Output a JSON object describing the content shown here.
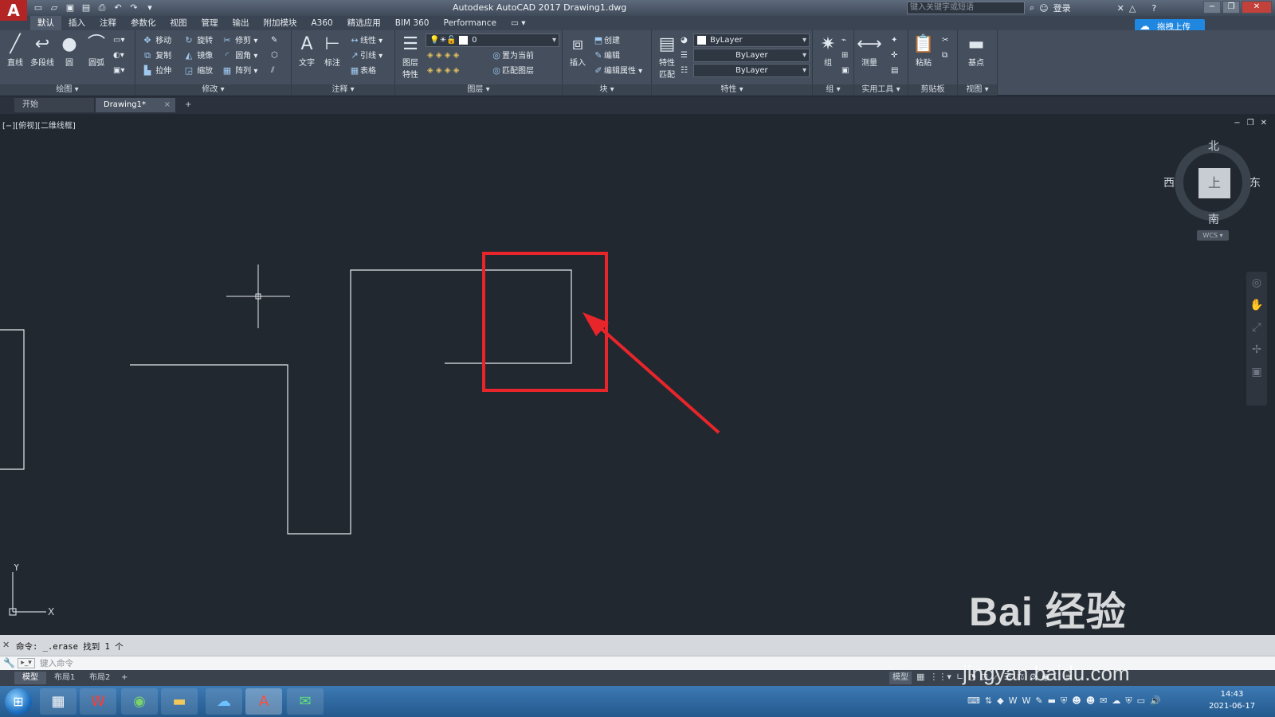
{
  "window": {
    "app_logo": "A",
    "title": "Autodesk AutoCAD 2017    Drawing1.dwg",
    "search_placeholder": "键入关键字或短语",
    "login_label": "登录",
    "upload_label": "拖拽上传"
  },
  "ribbon_tabs": [
    "默认",
    "插入",
    "注释",
    "参数化",
    "视图",
    "管理",
    "输出",
    "附加模块",
    "A360",
    "精选应用",
    "BIM 360",
    "Performance"
  ],
  "ribbon": {
    "draw": {
      "title": "绘图 ▾",
      "line": "直线",
      "polyline": "多段线",
      "circle": "圆",
      "arc": "圆弧"
    },
    "modify": {
      "title": "修改 ▾",
      "move": "移动",
      "rotate": "旋转",
      "trim": "修剪",
      "copy": "复制",
      "mirror": "镜像",
      "fillet": "圆角",
      "stretch": "拉伸",
      "scale": "缩放",
      "array": "阵列"
    },
    "annotation": {
      "title": "注释 ▾",
      "text": "文字",
      "dimension": "标注",
      "linear": "线性",
      "leader": "引线",
      "table": "表格"
    },
    "layers": {
      "title": "图层 ▾",
      "layer_props": "图层\n特性",
      "layer_value": "0",
      "set_current": "置为当前",
      "match_layer": "匹配图层"
    },
    "block": {
      "title": "块 ▾",
      "insert": "插入",
      "create": "创建",
      "edit": "编辑",
      "edit_attr": "编辑属性"
    },
    "properties": {
      "title": "特性 ▾",
      "match": "特性\n匹配",
      "color": "ByLayer",
      "linetype": "ByLayer",
      "lineweight": "ByLayer"
    },
    "groups": {
      "title": "组 ▾",
      "group": "组"
    },
    "utilities": {
      "title": "实用工具 ▾",
      "measure": "测量"
    },
    "clipboard": {
      "title": "剪贴板",
      "paste": "粘贴"
    },
    "view": {
      "title": "视图 ▾",
      "base": "基点"
    }
  },
  "file_tabs": {
    "start": "开始",
    "doc": "Drawing1*",
    "close": "×",
    "new": "+"
  },
  "viewport": {
    "label": "[−][俯视][二维线框]",
    "viewcube": {
      "north": "北",
      "south": "南",
      "west": "西",
      "east": "东",
      "top": "上",
      "wcs": "WCS ▾"
    },
    "ucs": {
      "x": "X",
      "y": "Y"
    }
  },
  "command": {
    "history": "命令: _.erase 找到 1 个",
    "placeholder": "键入命令",
    "prefix": "▸_▾"
  },
  "layout_tabs": [
    "模型",
    "布局1",
    "布局2",
    "+"
  ],
  "status": {
    "model": "模型"
  },
  "taskbar": {
    "clock_time": "14:43",
    "clock_date": "2021-06-17"
  },
  "watermark": {
    "brand": "Bai   经验",
    "url": "jingyan.baidu.com"
  },
  "colors": {
    "canvas": "#212830",
    "highlight": "#e8252a",
    "ribbon": "#444e5c"
  }
}
